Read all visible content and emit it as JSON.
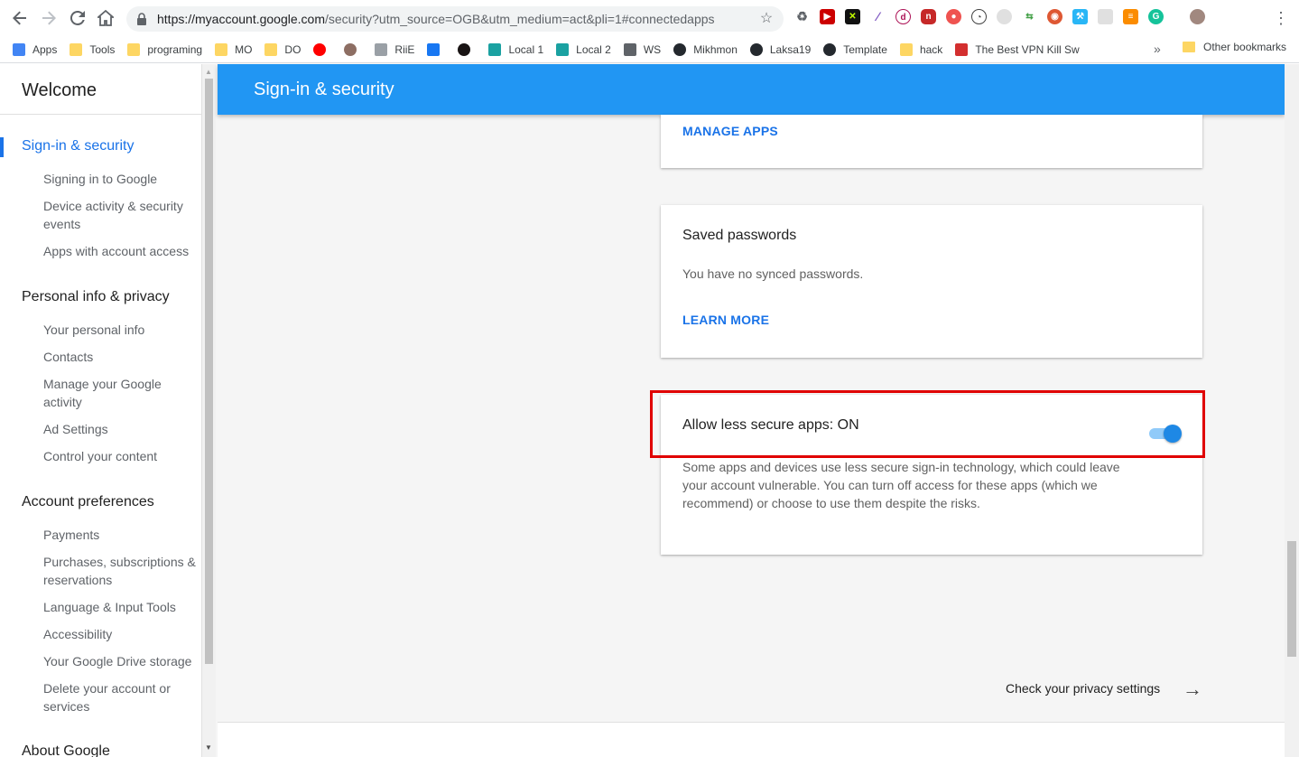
{
  "browser": {
    "url_host": "https://myaccount.google.com",
    "url_path": "/security?utm_source=OGB&utm_medium=act&pli=1#connectedapps",
    "bookmarks": [
      {
        "label": "Apps",
        "icon": "apps-grid-icon",
        "color": "#4285f4"
      },
      {
        "label": "Tools",
        "icon": "folder-icon",
        "color": "#fdd663"
      },
      {
        "label": "programing",
        "icon": "folder-icon",
        "color": "#fdd663"
      },
      {
        "label": "MO",
        "icon": "folder-icon",
        "color": "#fdd663"
      },
      {
        "label": "DO",
        "icon": "folder-icon",
        "color": "#fdd663"
      },
      {
        "label": "",
        "icon": "youtube-icon",
        "color": "#ff0000"
      },
      {
        "label": "",
        "icon": "avatar-icon",
        "color": "#8d6e63"
      },
      {
        "label": "RiiE",
        "icon": "page-icon",
        "color": "#9aa0a6"
      },
      {
        "label": "",
        "icon": "facebook-icon",
        "color": "#1877f2"
      },
      {
        "label": "",
        "icon": "spotify-icon",
        "color": "#191414"
      },
      {
        "label": "Local 1",
        "icon": "local-icon",
        "color": "#1aa1a1"
      },
      {
        "label": "Local 2",
        "icon": "local-icon",
        "color": "#1aa1a1"
      },
      {
        "label": "WS",
        "icon": "wireless-icon",
        "color": "#5f6368"
      },
      {
        "label": "Mikhmon",
        "icon": "github-icon",
        "color": "#24292e"
      },
      {
        "label": "Laksa19",
        "icon": "github-icon",
        "color": "#24292e"
      },
      {
        "label": "Template",
        "icon": "github-icon",
        "color": "#24292e"
      },
      {
        "label": "hack",
        "icon": "folder-icon",
        "color": "#fdd663"
      },
      {
        "label": "The Best VPN Kill Sw",
        "icon": "vpn-icon",
        "color": "#d32f2f"
      }
    ],
    "more_chevron": "»",
    "other_bookmarks": "Other bookmarks"
  },
  "sidebar": {
    "welcome": "Welcome",
    "sections": [
      {
        "title": "Sign-in & security",
        "items": [
          "Signing in to Google",
          "Device activity & security events",
          "Apps with account access"
        ]
      },
      {
        "title": "Personal info & privacy",
        "items": [
          "Your personal info",
          "Contacts",
          "Manage your Google activity",
          "Ad Settings",
          "Control your content"
        ]
      },
      {
        "title": "Account preferences",
        "items": [
          "Payments",
          "Purchases, subscriptions & reservations",
          "Language & Input Tools",
          "Accessibility",
          "Your Google Drive storage",
          "Delete your account or services"
        ]
      },
      {
        "title": "About Google",
        "items": []
      }
    ]
  },
  "header": {
    "title": "Sign-in & security"
  },
  "cards": {
    "manage_apps": {
      "link": "MANAGE APPS"
    },
    "saved_passwords": {
      "title": "Saved passwords",
      "text": "You have no synced passwords.",
      "link": "LEARN MORE"
    },
    "less_secure": {
      "title": "Allow less secure apps: ON",
      "toggle_on": true,
      "text": "Some apps and devices use less secure sign-in technology, which could leave your account vulnerable. You can turn off access for these apps (which we recommend) or choose to use them despite the risks."
    }
  },
  "footer": {
    "privacy_link": "Check your privacy settings",
    "arrow": "→"
  },
  "colors": {
    "accent": "#1a73e8",
    "header": "#2196f3",
    "highlight": "#e00000"
  }
}
